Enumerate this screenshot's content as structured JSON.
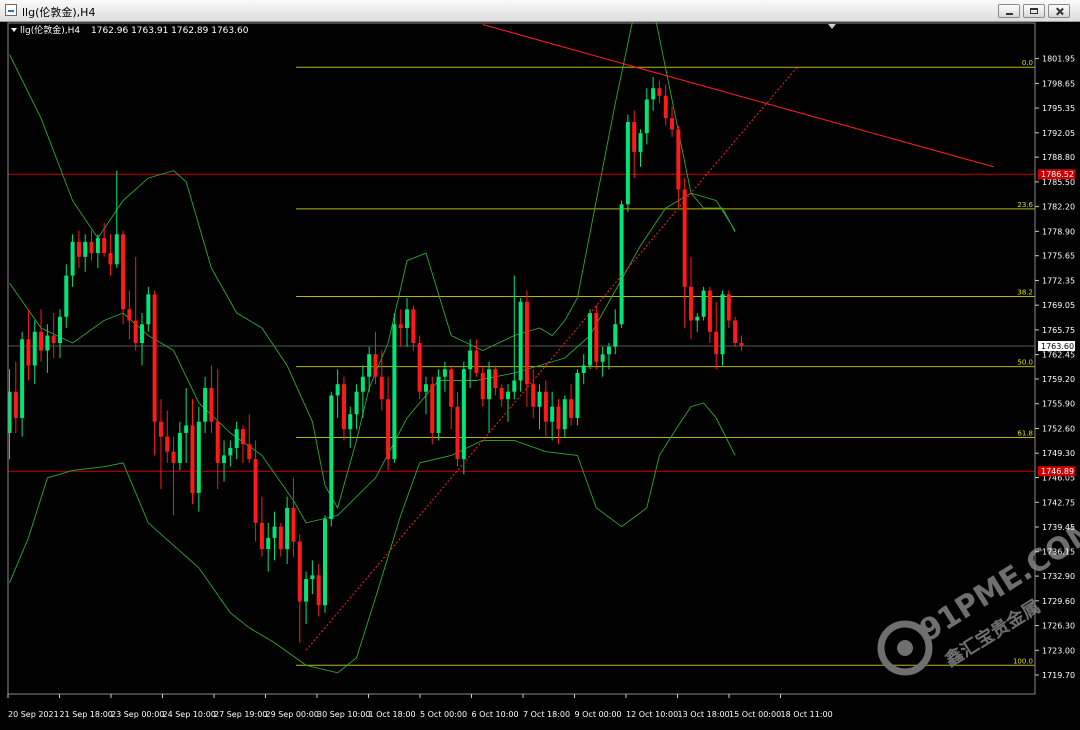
{
  "window": {
    "title": "llg(伦敦金),H4"
  },
  "info_bar": {
    "symbol": "llg(伦敦金),H4",
    "ohlc": "1762.96 1763.91 1762.89 1763.60"
  },
  "watermark": {
    "brand": "91PME.COM",
    "tagline": "鑫汇宝贵金属"
  },
  "colors": {
    "background": "#000000",
    "bull": "#00e676",
    "bear": "#ff1a1a",
    "bands": "#2eaa2e",
    "fib": "#b8b800",
    "hline": "#cc0000",
    "trend": "#ff2020",
    "axis_text": "#ffffff"
  },
  "chart_data": {
    "type": "candlestick",
    "ylim": [
      1719.7,
      1803.9
    ],
    "y_ticks": [
      "1801.95",
      "1798.65",
      "1795.35",
      "1792.05",
      "1788.80",
      "1785.50",
      "1782.20",
      "1778.90",
      "1775.65",
      "1772.35",
      "1769.05",
      "1765.75",
      "1762.45",
      "1759.20",
      "1755.90",
      "1752.60",
      "1749.30",
      "1746.05",
      "1742.75",
      "1739.45",
      "1736.15",
      "1732.90",
      "1729.60",
      "1726.30",
      "1723.00",
      "1719.70"
    ],
    "x_ticks": [
      "20 Sep 2021",
      "21 Sep 18:00",
      "23 Sep 00:00",
      "24 Sep 10:00",
      "27 Sep 19:00",
      "29 Sep 00:00",
      "30 Sep 10:00",
      "1 Oct 18:00",
      "5 Oct 00:00",
      "6 Oct 10:00",
      "7 Oct 18:00",
      "9 Oct 00:00",
      "12 Oct 10:00",
      "13 Oct 18:00",
      "15 Oct 00:00",
      "18 Oct 11:00"
    ],
    "candles": [
      [
        1752.0,
        1760.5,
        1748.5,
        1757.5
      ],
      [
        1757.5,
        1761.5,
        1752.0,
        1754.0
      ],
      [
        1754.0,
        1765.5,
        1751.5,
        1764.5
      ],
      [
        1764.5,
        1768.5,
        1759.0,
        1761.0
      ],
      [
        1761.0,
        1767.0,
        1758.5,
        1765.5
      ],
      [
        1765.5,
        1768.5,
        1761.5,
        1763.0
      ],
      [
        1763.0,
        1766.5,
        1760.0,
        1765.0
      ],
      [
        1765.0,
        1768.0,
        1762.0,
        1764.0
      ],
      [
        1764.0,
        1768.5,
        1762.0,
        1767.5
      ],
      [
        1767.5,
        1774.5,
        1766.0,
        1773.0
      ],
      [
        1773.0,
        1778.5,
        1771.5,
        1777.5
      ],
      [
        1777.5,
        1779.0,
        1774.0,
        1775.5
      ],
      [
        1775.5,
        1778.5,
        1773.5,
        1777.5
      ],
      [
        1777.5,
        1779.0,
        1775.0,
        1776.0
      ],
      [
        1776.0,
        1778.5,
        1774.0,
        1778.0
      ],
      [
        1778.0,
        1780.0,
        1775.5,
        1776.0
      ],
      [
        1776.0,
        1778.5,
        1773.0,
        1774.5
      ],
      [
        1774.5,
        1787.0,
        1774.0,
        1778.5
      ],
      [
        1778.5,
        1779.0,
        1766.5,
        1768.5
      ],
      [
        1768.5,
        1771.0,
        1764.5,
        1767.0
      ],
      [
        1767.0,
        1775.5,
        1763.0,
        1764.0
      ],
      [
        1764.0,
        1768.0,
        1761.0,
        1766.5
      ],
      [
        1766.5,
        1771.5,
        1765.5,
        1770.5
      ],
      [
        1770.5,
        1771.0,
        1749.0,
        1753.5
      ],
      [
        1753.5,
        1756.5,
        1744.5,
        1751.5
      ],
      [
        1751.5,
        1755.0,
        1748.0,
        1749.5
      ],
      [
        1749.5,
        1751.5,
        1741.0,
        1748.0
      ],
      [
        1748.0,
        1753.5,
        1747.0,
        1752.0
      ],
      [
        1752.0,
        1758.0,
        1748.0,
        1753.0
      ],
      [
        1753.0,
        1756.5,
        1742.5,
        1744.0
      ],
      [
        1744.0,
        1755.5,
        1741.5,
        1753.5
      ],
      [
        1753.5,
        1759.5,
        1752.0,
        1758.0
      ],
      [
        1758.0,
        1761.0,
        1752.0,
        1753.5
      ],
      [
        1753.5,
        1760.5,
        1744.5,
        1748.0
      ],
      [
        1748.0,
        1751.0,
        1745.5,
        1749.0
      ],
      [
        1749.0,
        1751.0,
        1747.5,
        1750.0
      ],
      [
        1750.0,
        1753.5,
        1748.5,
        1752.5
      ],
      [
        1752.5,
        1753.0,
        1748.0,
        1750.5
      ],
      [
        1750.5,
        1754.5,
        1748.0,
        1748.5
      ],
      [
        1748.5,
        1751.0,
        1737.5,
        1740.0
      ],
      [
        1740.0,
        1743.5,
        1735.5,
        1736.5
      ],
      [
        1736.5,
        1740.0,
        1733.5,
        1738.0
      ],
      [
        1738.0,
        1741.5,
        1735.0,
        1739.5
      ],
      [
        1739.5,
        1740.0,
        1735.5,
        1736.5
      ],
      [
        1736.5,
        1743.5,
        1734.5,
        1742.0
      ],
      [
        1742.0,
        1746.0,
        1735.5,
        1737.5
      ],
      [
        1737.5,
        1738.5,
        1724.0,
        1729.5
      ],
      [
        1729.5,
        1733.5,
        1726.5,
        1732.5
      ],
      [
        1732.5,
        1735.0,
        1730.5,
        1733.0
      ],
      [
        1733.0,
        1734.5,
        1727.5,
        1729.0
      ],
      [
        1729.0,
        1741.0,
        1728.0,
        1740.5
      ],
      [
        1740.5,
        1757.5,
        1739.5,
        1757.0
      ],
      [
        1757.0,
        1760.5,
        1754.0,
        1758.5
      ],
      [
        1758.5,
        1759.5,
        1751.0,
        1752.5
      ],
      [
        1752.5,
        1755.5,
        1750.0,
        1754.5
      ],
      [
        1754.5,
        1758.5,
        1752.5,
        1757.5
      ],
      [
        1757.5,
        1761.0,
        1754.0,
        1759.5
      ],
      [
        1759.5,
        1763.5,
        1757.5,
        1762.5
      ],
      [
        1762.5,
        1765.5,
        1758.5,
        1759.5
      ],
      [
        1759.5,
        1763.0,
        1755.0,
        1756.5
      ],
      [
        1756.5,
        1759.5,
        1747.0,
        1748.5
      ],
      [
        1748.5,
        1768.0,
        1748.0,
        1766.5
      ],
      [
        1766.5,
        1768.5,
        1763.5,
        1766.0
      ],
      [
        1766.0,
        1770.0,
        1763.5,
        1768.5
      ],
      [
        1768.5,
        1769.0,
        1763.0,
        1764.0
      ],
      [
        1764.0,
        1765.0,
        1756.5,
        1757.5
      ],
      [
        1757.5,
        1759.5,
        1754.5,
        1758.5
      ],
      [
        1758.5,
        1759.5,
        1750.5,
        1752.0
      ],
      [
        1752.0,
        1760.5,
        1751.0,
        1759.5
      ],
      [
        1759.5,
        1761.5,
        1757.5,
        1760.5
      ],
      [
        1760.5,
        1761.0,
        1752.5,
        1755.5
      ],
      [
        1755.5,
        1757.5,
        1747.5,
        1748.5
      ],
      [
        1748.5,
        1761.5,
        1746.5,
        1760.5
      ],
      [
        1760.5,
        1764.5,
        1758.0,
        1763.0
      ],
      [
        1763.0,
        1764.5,
        1759.5,
        1760.0
      ],
      [
        1760.0,
        1761.0,
        1755.5,
        1756.5
      ],
      [
        1756.5,
        1761.5,
        1752.0,
        1760.5
      ],
      [
        1760.5,
        1761.0,
        1757.0,
        1758.0
      ],
      [
        1758.0,
        1758.5,
        1755.5,
        1756.5
      ],
      [
        1756.5,
        1758.5,
        1753.5,
        1757.5
      ],
      [
        1757.5,
        1773.0,
        1756.5,
        1759.0
      ],
      [
        1759.0,
        1770.0,
        1757.5,
        1769.5
      ],
      [
        1769.5,
        1771.0,
        1755.5,
        1758.5
      ],
      [
        1758.5,
        1760.5,
        1754.0,
        1755.5
      ],
      [
        1755.5,
        1758.5,
        1752.5,
        1757.5
      ],
      [
        1757.5,
        1759.0,
        1751.5,
        1753.5
      ],
      [
        1753.5,
        1757.5,
        1751.0,
        1755.5
      ],
      [
        1755.5,
        1756.5,
        1750.5,
        1752.5
      ],
      [
        1752.5,
        1757.0,
        1751.5,
        1756.5
      ],
      [
        1756.5,
        1758.5,
        1753.0,
        1754.0
      ],
      [
        1754.0,
        1760.5,
        1753.0,
        1760.0
      ],
      [
        1760.0,
        1762.5,
        1758.5,
        1761.0
      ],
      [
        1761.0,
        1768.5,
        1760.5,
        1768.0
      ],
      [
        1768.0,
        1769.0,
        1760.5,
        1761.5
      ],
      [
        1761.5,
        1763.5,
        1759.5,
        1762.5
      ],
      [
        1762.5,
        1764.0,
        1760.5,
        1763.5
      ],
      [
        1763.5,
        1768.5,
        1762.5,
        1766.5
      ],
      [
        1766.5,
        1783.0,
        1766.0,
        1782.5
      ],
      [
        1782.5,
        1794.5,
        1781.5,
        1793.5
      ],
      [
        1793.5,
        1795.0,
        1786.0,
        1789.5
      ],
      [
        1789.5,
        1792.5,
        1787.5,
        1792.0
      ],
      [
        1792.0,
        1798.0,
        1790.5,
        1796.5
      ],
      [
        1796.5,
        1799.5,
        1795.0,
        1798.0
      ],
      [
        1798.0,
        1799.0,
        1796.0,
        1797.0
      ],
      [
        1797.0,
        1798.5,
        1793.0,
        1794.0
      ],
      [
        1794.0,
        1795.5,
        1791.5,
        1792.5
      ],
      [
        1792.5,
        1793.0,
        1782.0,
        1784.5
      ],
      [
        1784.5,
        1786.0,
        1766.0,
        1771.5
      ],
      [
        1771.5,
        1775.5,
        1764.5,
        1767.0
      ],
      [
        1767.0,
        1768.0,
        1765.5,
        1767.5
      ],
      [
        1767.5,
        1771.5,
        1767.0,
        1771.0
      ],
      [
        1771.0,
        1771.5,
        1764.0,
        1765.5
      ],
      [
        1765.5,
        1769.5,
        1760.5,
        1762.5
      ],
      [
        1762.5,
        1771.0,
        1761.0,
        1770.5
      ],
      [
        1770.5,
        1771.0,
        1766.0,
        1767.0
      ],
      [
        1767.0,
        1767.5,
        1763.5,
        1764.0
      ],
      [
        1764.0,
        1765.0,
        1762.9,
        1763.6
      ]
    ],
    "horizontal_lines": [
      {
        "price": 1786.52,
        "label": "1786.52"
      },
      {
        "price": 1746.89,
        "label": "1746.89"
      }
    ],
    "current_price": {
      "price": 1763.6,
      "label": "1763.60"
    },
    "fibonacci": {
      "levels": [
        {
          "label": "0.0",
          "price": 1800.8
        },
        {
          "label": "23.6",
          "price": 1781.9
        },
        {
          "label": "38.2",
          "price": 1770.2
        },
        {
          "label": "50.0",
          "price": 1760.85
        },
        {
          "label": "61.8",
          "price": 1751.4
        },
        {
          "label": "100.0",
          "price": 1721.0
        }
      ]
    },
    "trendline": {
      "from": {
        "bar": 75,
        "price": 1806.5
      },
      "to": {
        "bar": 156,
        "price": 1787.5
      }
    },
    "dashed_trend": {
      "from": {
        "bar": 47,
        "price": 1723.0
      },
      "to": {
        "bar": 125,
        "price": 1801.0
      }
    },
    "bollinger": {
      "upper": [
        [
          0,
          1802.5
        ],
        [
          5,
          1794
        ],
        [
          10,
          1783
        ],
        [
          14,
          1778
        ],
        [
          18,
          1783
        ],
        [
          22,
          1786
        ],
        [
          26,
          1787
        ],
        [
          28,
          1785.5
        ],
        [
          32,
          1774
        ],
        [
          36,
          1768
        ],
        [
          40,
          1766
        ],
        [
          44,
          1761
        ],
        [
          48,
          1753.5
        ],
        [
          50,
          1745
        ],
        [
          52,
          1742
        ],
        [
          55,
          1751
        ],
        [
          57,
          1758
        ],
        [
          60,
          1764
        ],
        [
          63,
          1775
        ],
        [
          66,
          1776
        ],
        [
          70,
          1765
        ],
        [
          75,
          1763
        ],
        [
          80,
          1765
        ],
        [
          84,
          1766
        ],
        [
          86,
          1765
        ],
        [
          88,
          1767
        ],
        [
          90,
          1770
        ],
        [
          93,
          1783
        ],
        [
          96,
          1796
        ],
        [
          99,
          1808
        ],
        [
          101,
          1813
        ],
        [
          108,
          1784
        ],
        [
          110,
          1782
        ],
        [
          113,
          1782
        ],
        [
          115,
          1778.8
        ]
      ],
      "middle": [
        [
          0,
          1772
        ],
        [
          5,
          1766
        ],
        [
          10,
          1764
        ],
        [
          15,
          1767
        ],
        [
          18,
          1768
        ],
        [
          22,
          1765
        ],
        [
          26,
          1763
        ],
        [
          30,
          1756
        ],
        [
          35,
          1752
        ],
        [
          40,
          1749
        ],
        [
          45,
          1743
        ],
        [
          47,
          1740
        ],
        [
          52,
          1741
        ],
        [
          58,
          1746
        ],
        [
          63,
          1754
        ],
        [
          68,
          1759
        ],
        [
          74,
          1759
        ],
        [
          80,
          1760
        ],
        [
          84,
          1761
        ],
        [
          88,
          1762
        ],
        [
          92,
          1765
        ],
        [
          96,
          1771
        ],
        [
          100,
          1777
        ],
        [
          104,
          1782
        ],
        [
          108,
          1784
        ],
        [
          112,
          1783
        ],
        [
          115,
          1779
        ]
      ],
      "lower": [
        [
          0,
          1732
        ],
        [
          3,
          1738
        ],
        [
          6,
          1746
        ],
        [
          10,
          1747
        ],
        [
          15,
          1747.5
        ],
        [
          18,
          1748
        ],
        [
          22,
          1740
        ],
        [
          26,
          1737
        ],
        [
          30,
          1734
        ],
        [
          35,
          1728
        ],
        [
          38,
          1726
        ],
        [
          42,
          1724
        ],
        [
          47,
          1721
        ],
        [
          52,
          1720
        ],
        [
          55,
          1722
        ],
        [
          58,
          1730
        ],
        [
          62,
          1741
        ],
        [
          65,
          1748
        ],
        [
          70,
          1749
        ],
        [
          75,
          1751
        ],
        [
          80,
          1751
        ],
        [
          85,
          1749.5
        ],
        [
          90,
          1749
        ],
        [
          93,
          1742
        ],
        [
          97,
          1739.5
        ],
        [
          101,
          1742
        ],
        [
          103,
          1749
        ],
        [
          106,
          1753
        ],
        [
          108,
          1755.5
        ],
        [
          110,
          1756
        ],
        [
          112,
          1754
        ],
        [
          115,
          1749
        ]
      ]
    }
  }
}
